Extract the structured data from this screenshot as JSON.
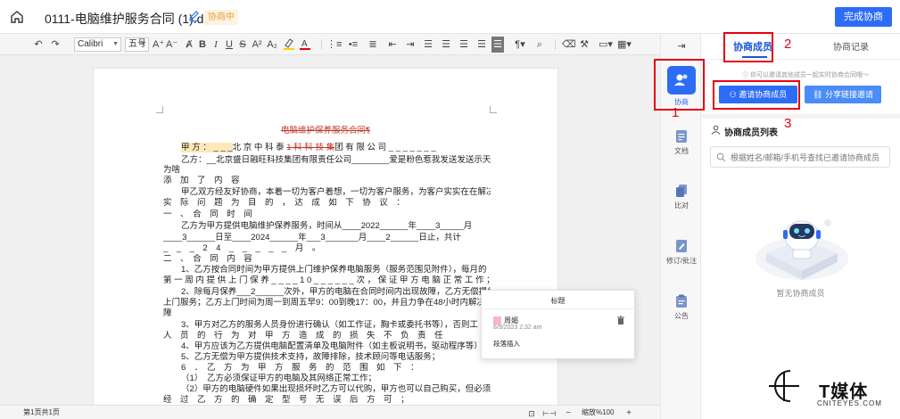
{
  "header": {
    "doc_title": "0111-电脑维护服务合同 (1).docx",
    "status_tag": "协商中",
    "finish_button": "完成协商"
  },
  "toolbar": {
    "font_name": "Calibri",
    "font_size": "五号",
    "bold": "B",
    "italic": "I",
    "underline": "U",
    "strike": "S",
    "superscript": "A²",
    "subscript": "A₂",
    "grow_font": "A⁺",
    "shrink_font": "A⁻"
  },
  "document": {
    "heading": "电脑维护保养服务合同¶",
    "party_a_label": "甲 方 ： _ _ _",
    "party_a_name_1": "北 京 中 科 泰",
    "party_a_deleted": "1 科 科 技 集",
    "party_a_name_2": "团 有 限 公 司 _ _ _ _ _ _ _",
    "lines": [
      "乙方：__北京盛日融旺科技集团有限责任公司________爱是粉色惹我发送发送示天",
      "为啥",
      "添　加　了　内　容",
      "甲乙双方经友好协商，本着一切为客户着想，一切为客户服务，为客户实实在在解决",
      "实　际　问　题　为　目　的　，　达　成　如　下　协　议　：",
      "一　、　合　同　时　间",
      "乙方为甲方提供电脑维护保养服务，时间从____2022______年____3_____月",
      "____3______日至____2024______年___3_______月____2______日止，共计",
      "_　_　_　2　4　_　_　_　_　_　月　。",
      "二　、　合　同　内　容",
      "1、乙方按合同时间为甲方提供上门维护保养电脑服务（服务范围见附件），每月的",
      "第 一 周 内 提 供 上 门 保 养 _ _ _ _ 1 0 _ _ _ _ _ _ 次 ， 保 证 甲 方 电 脑 正 常 工 作 ；",
      "2、除每月保养___2______次外，甲方的电脑在合同时间内出现故障，乙方无偿提供",
      "上门服务；乙方上门时间为周一到周五早9：00到晚17：00，并且力争在48小时内解决",
      "障",
      "3、甲方对乙方的服务人员身份进行确认（如工作证，胸卡或委托书等），否则工",
      "人　员　的　行　为　对　甲　方　造　成　的　损　失　不　负　责　任",
      "4、甲方应该为乙方提供电脑配置清单及电脑附件（如主板说明书，驱动程序等）",
      "5、乙方无偿为甲方提供技术支持，故障排除，技术顾问等电话服务；",
      "6　．　乙　方　为　甲　方　服　务　的　范　围　如　下　：",
      "（1）　乙方必须保证甲方的电脑及其网络正常工作；",
      "（2）甲方的电脑硬件如果出现损坏时乙方可以代购，甲方也可以自己购买，但必须",
      "经　过　乙　方　的　确　定　型　号　无　误　后　方　可　；"
    ]
  },
  "comment": {
    "title": "标题",
    "author": "周媚",
    "time": "8/9/2023 2:32 am",
    "text": "段落插入"
  },
  "statusbar": {
    "page_info": "第1页共1页",
    "zoom": "缩放%100"
  },
  "rail": {
    "items": [
      {
        "label": "协商"
      },
      {
        "label": "文档"
      },
      {
        "label": "比对"
      },
      {
        "label": "修订/批注"
      },
      {
        "label": "公告"
      }
    ]
  },
  "panel": {
    "tab_members": "协商成员",
    "tab_records": "协商记录",
    "hint": "ⓘ 你可以邀请其他成员一起实时协商合同哦～",
    "invite_button": "邀请协商成员",
    "share_button": "分享链接邀请",
    "list_title": "协商成员列表",
    "search_placeholder": "根据姓名/邮箱/手机号查找已邀请协商成员",
    "empty_text": "暂无协商成员"
  },
  "annotations": {
    "n1": "1",
    "n2": "2",
    "n3": "3"
  },
  "watermark": {
    "title": "T媒体",
    "subtitle": "CNITEYES.COM"
  },
  "colors": {
    "primary": "#2d6cf6",
    "accent_red": "#e60012",
    "status_orange": "#e6a23c",
    "deleted_red": "#c0392b"
  }
}
